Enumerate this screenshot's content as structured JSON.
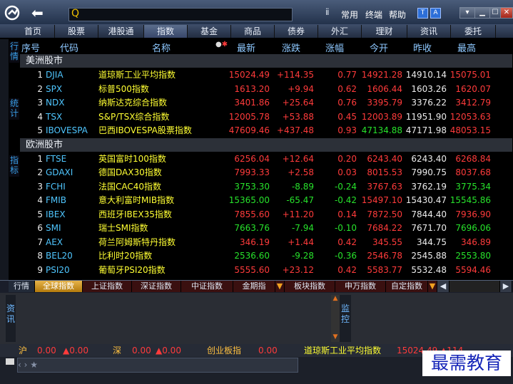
{
  "titlebar": {
    "search_icon": "Q",
    "pin_icon": "ⅱ",
    "menu": [
      "常用",
      "终端",
      "帮助"
    ],
    "window_buttons": [
      "▾",
      "▁",
      "☐",
      "✕"
    ],
    "icons": [
      "T",
      "A"
    ]
  },
  "nav": [
    "首页",
    "股票",
    "港股通",
    "指数",
    "基金",
    "商品",
    "债券",
    "外汇",
    "理财",
    "资讯",
    "委托"
  ],
  "nav_active": "指数",
  "left_tabs": [
    "行情",
    "统计",
    "指标"
  ],
  "columns": [
    "序号",
    "代码",
    "名称",
    "最新",
    "涨跌",
    "涨幅",
    "今开",
    "昨收",
    "最高"
  ],
  "groups": [
    {
      "title": "美洲股市",
      "rows": [
        {
          "n": "1",
          "code": "DJIA",
          "name": "道琼斯工业平均指数",
          "last": "15024.49",
          "chg": "+114.35",
          "pct": "0.77",
          "open": "14921.28",
          "prev": "14910.14",
          "high": "15075.01",
          "dir": "up"
        },
        {
          "n": "2",
          "code": "SPX",
          "name": "标普500指数",
          "last": "1613.20",
          "chg": "+9.94",
          "pct": "0.62",
          "open": "1606.44",
          "prev": "1603.26",
          "high": "1620.07",
          "dir": "up"
        },
        {
          "n": "3",
          "code": "NDX",
          "name": "纳斯达克综合指数",
          "last": "3401.86",
          "chg": "+25.64",
          "pct": "0.76",
          "open": "3395.79",
          "prev": "3376.22",
          "high": "3412.79",
          "dir": "up"
        },
        {
          "n": "4",
          "code": "TSX",
          "name": "S&P/TSX综合指数",
          "last": "12005.78",
          "chg": "+53.88",
          "pct": "0.45",
          "open": "12003.89",
          "prev": "11951.90",
          "high": "12053.63",
          "dir": "up"
        },
        {
          "n": "5",
          "code": "IBOVESPA",
          "name": "巴西IBOVESPA股票指数",
          "last": "47609.46",
          "chg": "+437.48",
          "pct": "0.93",
          "open": "47134.88",
          "prev": "47171.98",
          "high": "48053.15",
          "dir": "up"
        }
      ]
    },
    {
      "title": "欧洲股市",
      "rows": [
        {
          "n": "1",
          "code": "FTSE",
          "name": "英国富时100指数",
          "last": "6256.04",
          "chg": "+12.64",
          "pct": "0.20",
          "open": "6243.40",
          "prev": "6243.40",
          "high": "6268.84",
          "dir": "up"
        },
        {
          "n": "2",
          "code": "GDAXI",
          "name": "德国DAX30指数",
          "last": "7993.33",
          "chg": "+2.58",
          "pct": "0.03",
          "open": "8015.53",
          "prev": "7990.75",
          "high": "8037.68",
          "dir": "up"
        },
        {
          "n": "3",
          "code": "FCHI",
          "name": "法国CAC40指数",
          "last": "3753.30",
          "chg": "-8.89",
          "pct": "-0.24",
          "open": "3767.63",
          "prev": "3762.19",
          "high": "3775.34",
          "dir": "down"
        },
        {
          "n": "4",
          "code": "FMIB",
          "name": "意大利富时MIB指数",
          "last": "15365.00",
          "chg": "-65.47",
          "pct": "-0.42",
          "open": "15497.10",
          "prev": "15430.47",
          "high": "15545.86",
          "dir": "down"
        },
        {
          "n": "5",
          "code": "IBEX",
          "name": "西班牙IBEX35指数",
          "last": "7855.60",
          "chg": "+11.20",
          "pct": "0.14",
          "open": "7872.50",
          "prev": "7844.40",
          "high": "7936.90",
          "dir": "up"
        },
        {
          "n": "6",
          "code": "SMI",
          "name": "瑞士SMI指数",
          "last": "7663.76",
          "chg": "-7.94",
          "pct": "-0.10",
          "open": "7684.22",
          "prev": "7671.70",
          "high": "7696.06",
          "dir": "down"
        },
        {
          "n": "7",
          "code": "AEX",
          "name": "荷兰阿姆斯特丹指数",
          "last": "346.19",
          "chg": "+1.44",
          "pct": "0.42",
          "open": "345.55",
          "prev": "344.75",
          "high": "346.89",
          "dir": "up"
        },
        {
          "n": "8",
          "code": "BEL20",
          "name": "比利时20指数",
          "last": "2536.60",
          "chg": "-9.28",
          "pct": "-0.36",
          "open": "2546.78",
          "prev": "2545.88",
          "high": "2553.80",
          "dir": "down"
        },
        {
          "n": "9",
          "code": "PSI20",
          "name": "葡萄牙PSI20指数",
          "last": "5555.60",
          "chg": "+23.12",
          "pct": "0.42",
          "open": "5583.77",
          "prev": "5532.48",
          "high": "5594.46",
          "dir": "up"
        }
      ]
    }
  ],
  "bottom_tabs": [
    "行情",
    "全球指数",
    "上证指数",
    "深证指数",
    "中证指数",
    "金期指",
    "板块指数",
    "申万指数",
    "自定指数"
  ],
  "bottom_active": "全球指数",
  "info_left": "资讯",
  "info_right": "监控",
  "status": {
    "sh_label": "沪",
    "sh_val": "0.00",
    "sh_chg": "▲0.00",
    "sz_label": "深",
    "sz_val": "0.00",
    "sz_chg": "▲0.00",
    "cyb_label": "创业板指",
    "cyb_val": "0.00",
    "ticker_name": "道琼斯工业平均指数",
    "ticker_val": "15024.49 ▲114"
  },
  "cmd": "‹ › ★",
  "watermark": "最需教育"
}
